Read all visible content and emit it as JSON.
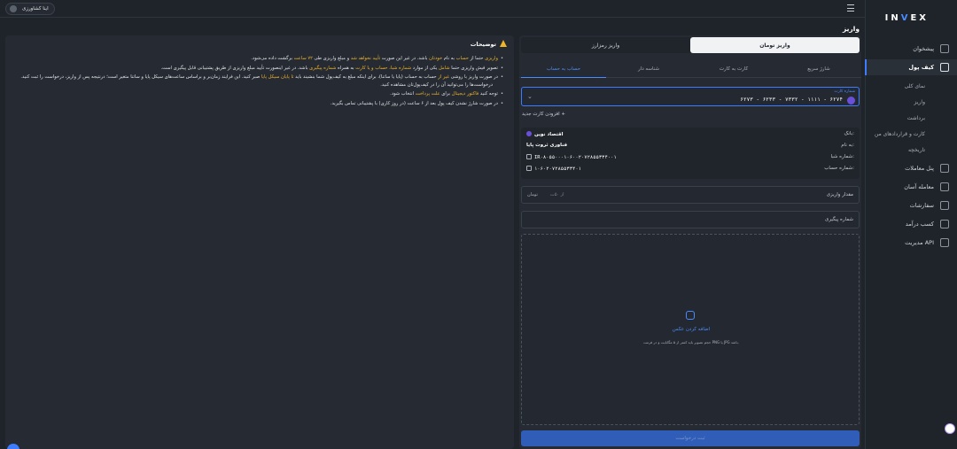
{
  "brand": {
    "logo_prefix": "IN",
    "logo_v": "V",
    "logo_suffix": "EX",
    "accent": "#3d7cff"
  },
  "topbar": {
    "user_name": "اینا کشاورزی",
    "menu_icon": "hamburger-icon"
  },
  "page_title": "واریز",
  "sidebar": {
    "items": [
      {
        "label": "پیشخوان",
        "icon": "dashboard-icon"
      },
      {
        "label": "کیف پول",
        "icon": "wallet-icon",
        "active": true
      },
      {
        "label": "پنل معاملات",
        "icon": "trade-icon"
      },
      {
        "label": "معامله آسان",
        "icon": "easy-trade-icon"
      },
      {
        "label": "سفارشات",
        "icon": "orders-icon"
      },
      {
        "label": "کسب درآمد",
        "icon": "earn-icon"
      },
      {
        "label": "مدیریت API",
        "icon": "api-icon"
      }
    ],
    "wallet_sub": [
      "نمای کلی",
      "واریز",
      "برداشت",
      "کارت و قراردادهای من",
      "تاریخچه"
    ]
  },
  "deposit": {
    "segments": [
      "واریز تومان",
      "واریز رمزارز"
    ],
    "tabs": [
      "شارژ سریع",
      "کارت به کارت",
      "شناسه دار",
      "حساب به حساب"
    ],
    "card": {
      "label": "شماره کارت",
      "number": "۶۲۷۳ - ۶۲۳۳ - ۷۳۳۲ - ۱۱۱۱ - ۶۲۷۴",
      "bank_icon": "bank-logo-icon"
    },
    "add_card": "افزودن کارت جدید",
    "details": [
      {
        "key": "بانک:",
        "value": "اقتصاد نوین"
      },
      {
        "key": "به نام:",
        "value": "فناوری ثروت پایا"
      },
      {
        "key": "شماره شبا:",
        "value": "IR۰۸۰۵۵۰۰۰۱۰۶۰۰۲۰۷۲۸۵۵۳۳۴۰۰۱"
      },
      {
        "key": "شماره حساب:",
        "value": "۱۰۶۰۲۰۷۲۸۵۵۳۳۴۰۱"
      }
    ],
    "amount_field": {
      "placeholder": "مقدار واریزی",
      "hint": "از ۵۰ت",
      "unit": "تومان"
    },
    "tracking_field": {
      "placeholder": "شماره پیگیری"
    },
    "upload": {
      "title": "اضافه کردن عکس",
      "desc": "حجم تصویر باید کمتر از ۵ مگابایت و در فرمت PNG یا JPG باشد."
    },
    "submit": "ثبت درخواست"
  },
  "info": {
    "title": "توضیحات",
    "bullets": [
      [
        "واریزی",
        " حتما از ",
        "حساب",
        " به نام ",
        "خودتان",
        " باشد. در غیر این صورت ",
        "تأیید نخواهد شد",
        " و مبلغ واریزی طی ",
        "۷۲ ساعت",
        " برگشت داده می‌شود."
      ],
      [
        "تصویر فیش واریزی حتما ",
        "شامل",
        " یکی از موارد ",
        "شماره شبا، حساب و یا کارت",
        " به همراه ",
        "شماره پیگیری",
        " باشد. در غیر اینصورت تأیید مبلغ واریزی از طریق پشتیبانی قابل پیگیری است."
      ],
      [
        "در صورت واریز با روشی ",
        "غیر از",
        " حساب به حساب (پایا یا ساتنا)، برای اینکه مبلغ به کیف‌پول شما بنشیند باید ",
        "تا پایان سیکل پایا",
        " صبر کنید. این فرایند زمان‌بر و براساس ساعت‌های سیکل پایا و ساتنا متغیر است؛ درنتیجه پس از واریز، درخواست را ثبت کنید."
      ],
      [
        "توجه کنید ",
        "فاکتور دیجیتال",
        " برای ",
        "علت پرداخت",
        " انتخاب شود."
      ],
      [
        "در صورت شارژ نشدن کیف پول بعد از ۶ ساعت (در روز کاری) با پشتیبانی تماس بگیرید."
      ]
    ],
    "sub_line": "درخواست‌ها را می‌توانید آن را در کیف‌پول‌تان مشاهده کنید."
  }
}
